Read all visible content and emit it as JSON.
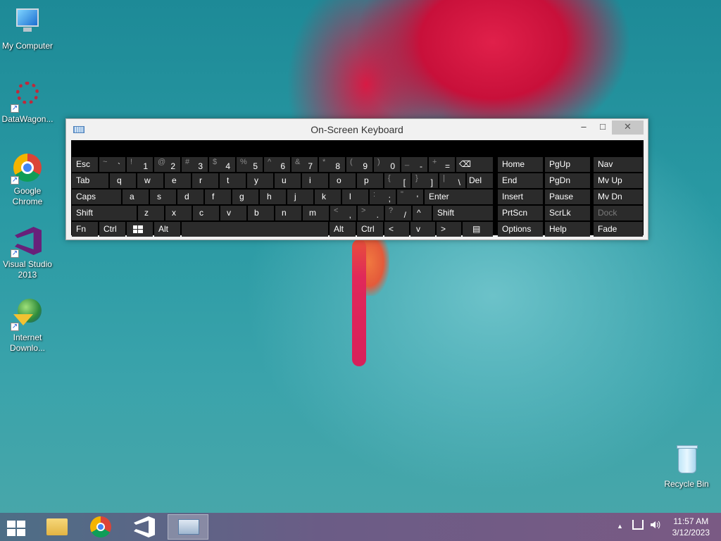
{
  "desktop": {
    "icons": [
      {
        "label": "My Computer",
        "icon": "my-computer-icon"
      },
      {
        "label": "DataWagon...",
        "icon": "datawagon-icon"
      },
      {
        "label": "Google Chrome",
        "icon": "chrome-icon"
      },
      {
        "label": "Visual Studio 2013",
        "icon": "visual-studio-icon"
      },
      {
        "label": "Internet Downlo...",
        "icon": "internet-download-manager-icon"
      },
      {
        "label": "Recycle Bin",
        "icon": "recycle-bin-icon"
      }
    ]
  },
  "osk": {
    "title": "On-Screen Keyboard",
    "minimize": "–",
    "maximize": "□",
    "close": "✕",
    "row1": {
      "esc": "Esc",
      "digits": [
        {
          "shift": "~",
          "base": "`"
        },
        {
          "shift": "!",
          "base": "1"
        },
        {
          "shift": "@",
          "base": "2"
        },
        {
          "shift": "#",
          "base": "3"
        },
        {
          "shift": "$",
          "base": "4"
        },
        {
          "shift": "%",
          "base": "5"
        },
        {
          "shift": "^",
          "base": "6"
        },
        {
          "shift": "&",
          "base": "7"
        },
        {
          "shift": "*",
          "base": "8"
        },
        {
          "shift": "(",
          "base": "9"
        },
        {
          "shift": ")",
          "base": "0"
        },
        {
          "shift": "_",
          "base": "-"
        },
        {
          "shift": "+",
          "base": "="
        }
      ],
      "backspace": "⌫"
    },
    "row2": {
      "tab": "Tab",
      "letters": [
        "q",
        "w",
        "e",
        "r",
        "t",
        "y",
        "u",
        "i",
        "o",
        "p"
      ],
      "bracket_open": {
        "shift": "{",
        "base": "["
      },
      "bracket_close": {
        "shift": "}",
        "base": "]"
      },
      "backslash": {
        "shift": "|",
        "base": "\\"
      },
      "del": "Del"
    },
    "row3": {
      "caps": "Caps",
      "letters": [
        "a",
        "s",
        "d",
        "f",
        "g",
        "h",
        "j",
        "k",
        "l"
      ],
      "semicolon": {
        "shift": ":",
        "base": ";"
      },
      "quote": {
        "shift": "\"",
        "base": "'"
      },
      "enter": "Enter"
    },
    "row4": {
      "shift_left": "Shift",
      "letters": [
        "z",
        "x",
        "c",
        "v",
        "b",
        "n",
        "m"
      ],
      "comma": {
        "shift": "<",
        "base": ","
      },
      "period": {
        "shift": ">",
        "base": "."
      },
      "slash": {
        "shift": "?",
        "base": "/"
      },
      "up": "^",
      "shift_right": "Shift"
    },
    "row5": {
      "fn": "Fn",
      "ctrl_left": "Ctrl",
      "win": "win",
      "alt_left": "Alt",
      "alt_right": "Alt",
      "ctrl_right": "Ctrl",
      "left": "<",
      "down": "v",
      "right": ">",
      "menu": "▤"
    },
    "nav": {
      "home": "Home",
      "pgup": "PgUp",
      "nav": "Nav",
      "end": "End",
      "pgdn": "PgDn",
      "mvup": "Mv Up",
      "insert": "Insert",
      "pause": "Pause",
      "mvdn": "Mv Dn",
      "prtscn": "PrtScn",
      "scrlk": "ScrLk",
      "dock": "Dock",
      "options": "Options",
      "help": "Help",
      "fade": "Fade"
    }
  },
  "taskbar": {
    "time": "11:57 AM",
    "date": "3/12/2023",
    "tray_chevron": "▲"
  }
}
